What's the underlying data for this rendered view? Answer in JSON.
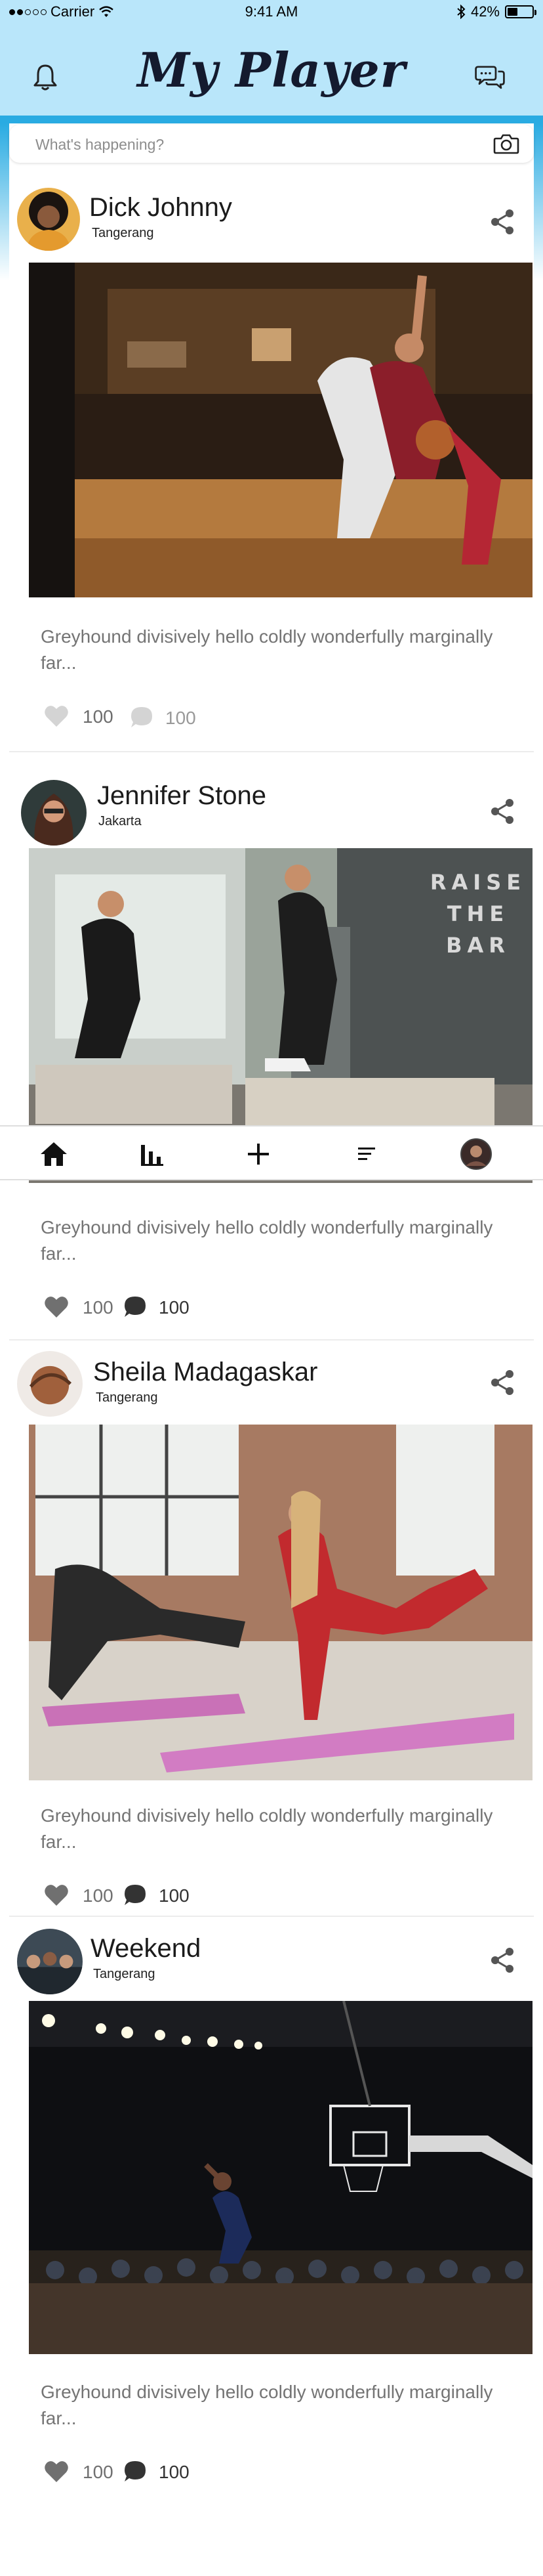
{
  "status_bar": {
    "carrier": "Carrier",
    "time": "9:41 AM",
    "battery": "42%",
    "battery_level": 0.42
  },
  "header": {
    "title": "My Player"
  },
  "compose": {
    "placeholder": "What's happening?"
  },
  "posts": [
    {
      "name": "Dick Johnny",
      "location": "Tangerang",
      "caption": "Greyhound divisively hello coldly wonderfully marginally far...",
      "likes": "100",
      "comments": "100",
      "photo": "basketball-game-photo"
    },
    {
      "name": "Jennifer Stone",
      "location": "Jakarta",
      "caption": "Greyhound divisively hello coldly wonderfully marginally far...",
      "likes": "100",
      "comments": "100",
      "photo": "box-jump-gym-photo",
      "wall_text": "RAISE THE BAR"
    },
    {
      "name": "Sheila Madagaskar",
      "location": "Tangerang",
      "caption": "Greyhound divisively hello coldly wonderfully marginally far...",
      "likes": "100",
      "comments": "100",
      "photo": "yoga-class-photo"
    },
    {
      "name": "Weekend",
      "location": "Tangerang",
      "caption": "Greyhound divisively hello coldly wonderfully marginally far...",
      "likes": "100",
      "comments": "100",
      "photo": "dunk-arena-photo"
    }
  ],
  "bottom_nav": {
    "items": [
      "home-icon",
      "stats-icon",
      "plus-icon",
      "feed-icon",
      "profile-avatar"
    ]
  },
  "colors": {
    "header_bg": "#b9e6fa",
    "accent": "#29abe2",
    "title": "#141a2e",
    "caption": "#747474"
  }
}
